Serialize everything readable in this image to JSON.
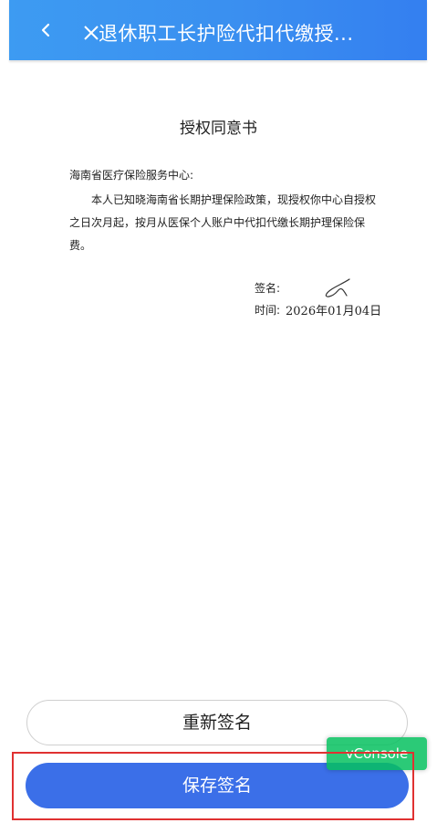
{
  "header": {
    "title": "退休职工长护险代扣代缴授...",
    "back_icon": "chevron-left-icon",
    "close_icon": "close-icon",
    "color": "#3a8ff0"
  },
  "document": {
    "title": "授权同意书",
    "recipient": "海南省医疗保险服务中心:",
    "body": "本人已知晓海南省长期护理保险政策，现授权你中心自授权之日次月起，按月从医保个人账户中代扣代缴长期护理保险保费。",
    "sign_label": "签名:",
    "time_label": "时间:",
    "time_value": "2026年01月04日"
  },
  "actions": {
    "resign_label": "重新签名",
    "save_label": "保存签名",
    "save_color": "#3b6fe8"
  },
  "vconsole": {
    "label": "vConsole",
    "color": "#07c160"
  },
  "annotation": {
    "highlight_color": "#e03131"
  }
}
